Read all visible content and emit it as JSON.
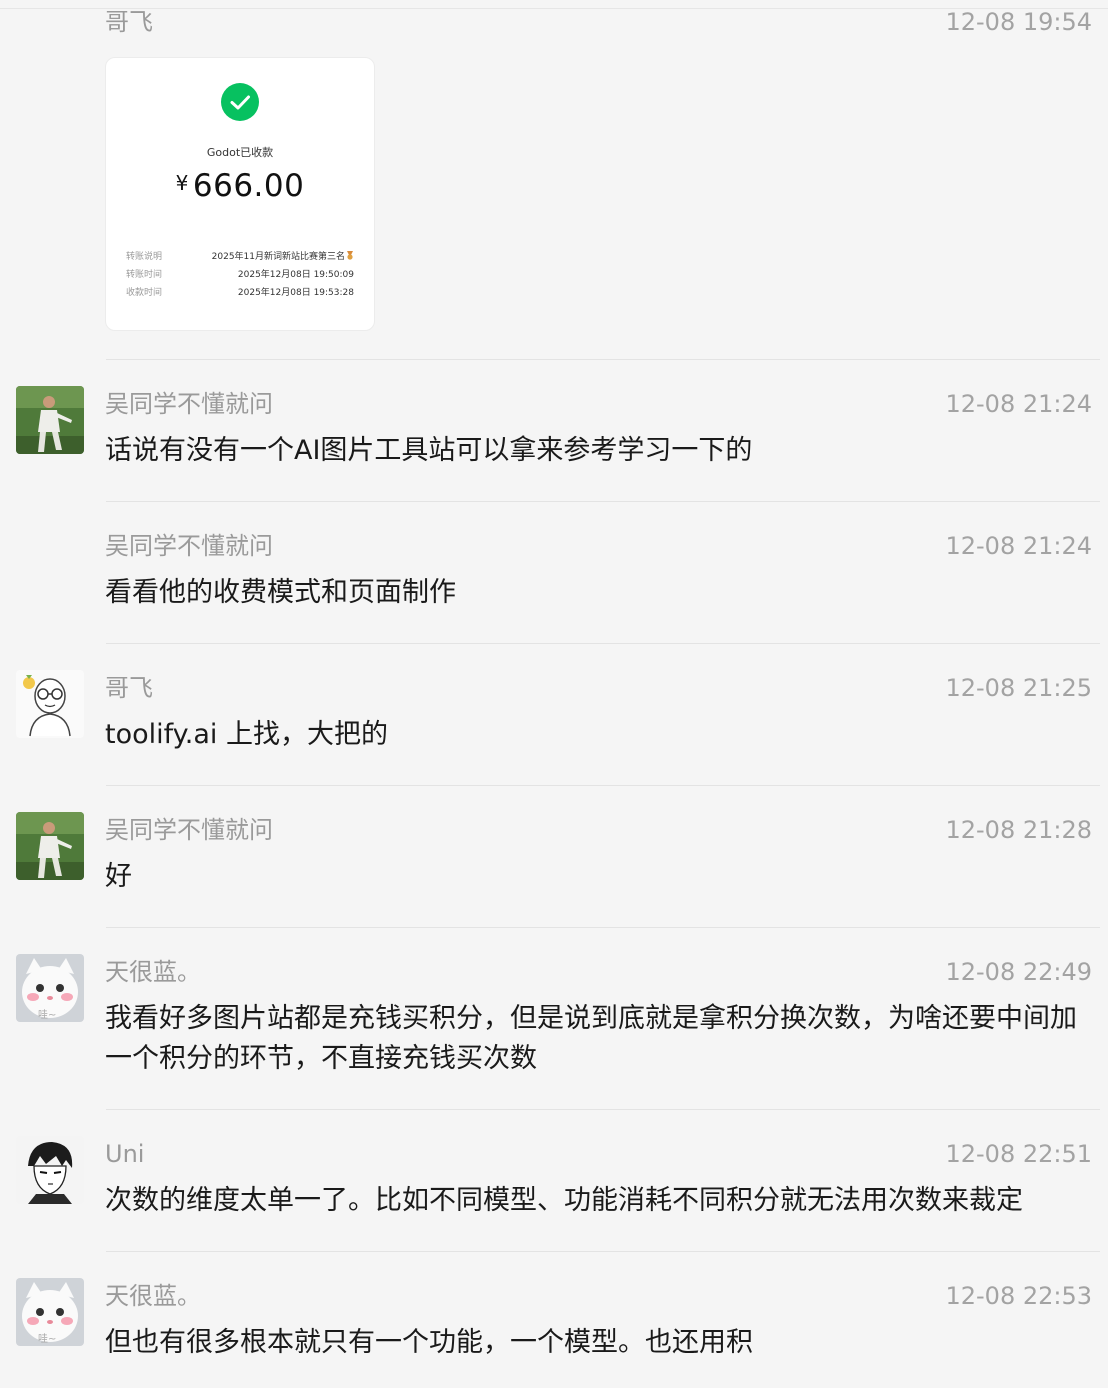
{
  "messages": [
    {
      "sender": "哥飞",
      "time": "12-08 19:54",
      "transfer": {
        "status": "Godot已收款",
        "currency": "¥",
        "amount": "666.00",
        "rows": [
          {
            "label": "转账说明",
            "value": "2025年11月新词新站比赛第三名"
          },
          {
            "label": "转账时间",
            "value": "2025年12月08日 19:50:09"
          },
          {
            "label": "收款时间",
            "value": "2025年12月08日 19:53:28"
          }
        ]
      }
    },
    {
      "sender": "吴同学不懂就问",
      "time": "12-08 21:24",
      "text": "话说有没有一个AI图片工具站可以拿来参考学习一下的",
      "avatar": "photo-avatar-man"
    },
    {
      "sender": "吴同学不懂就问",
      "time": "12-08 21:24",
      "text": "看看他的收费模式和页面制作"
    },
    {
      "sender": "哥飞",
      "time": "12-08 21:25",
      "text": "toolify.ai 上找，大把的",
      "avatar": "cartoon-avatar-glasses"
    },
    {
      "sender": "吴同学不懂就问",
      "time": "12-08 21:28",
      "text": "好",
      "avatar": "photo-avatar-man"
    },
    {
      "sender": "天很蓝。",
      "time": "12-08 22:49",
      "text": "我看好多图片站都是充钱买积分，但是说到底就是拿积分换次数，为啥还要中间加一个积分的环节，不直接充钱买次数",
      "avatar": "cat-avatar",
      "avatar_caption": "哇~"
    },
    {
      "sender": "Uni",
      "time": "12-08 22:51",
      "text": "次数的维度太单一了。比如不同模型、功能消耗不同积分就无法用次数来裁定",
      "avatar": "anime-avatar"
    },
    {
      "sender": "天很蓝。",
      "time": "12-08 22:53",
      "text": "但也有很多根本就只有一个功能，一个模型。也还用积",
      "avatar": "cat-avatar",
      "avatar_caption": "哇~"
    }
  ]
}
